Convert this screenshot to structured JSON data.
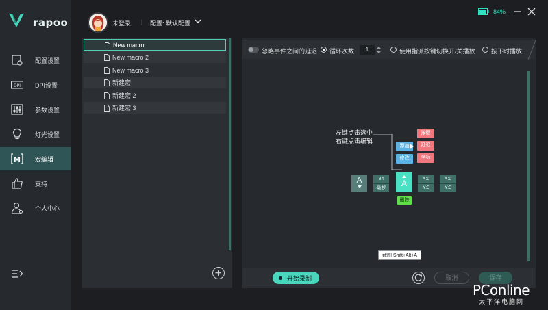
{
  "app": {
    "brand": "rapoo",
    "user_name": "未登录",
    "separator": "|",
    "profile_label": "配置: 默认配置",
    "battery_pct": "84%",
    "colors": {
      "accent": "#4ad6bd",
      "active_nav": "#2f5556",
      "background": "#1c1e21"
    }
  },
  "sidebar": {
    "items": [
      {
        "label": "配置设置",
        "icon": "config-icon",
        "active": false
      },
      {
        "label": "DPI设置",
        "icon": "dpi-icon",
        "active": false
      },
      {
        "label": "参数设置",
        "icon": "sliders-icon",
        "active": false
      },
      {
        "label": "灯光设置",
        "icon": "bulb-icon",
        "active": false
      },
      {
        "label": "宏编辑",
        "icon": "macro-icon",
        "active": true
      },
      {
        "label": "支持",
        "icon": "thumb-up-icon",
        "active": false
      },
      {
        "label": "个人中心",
        "icon": "user-icon",
        "active": false
      }
    ],
    "dpi_icon_text": "DPI",
    "macro_icon_text": "M"
  },
  "macros": {
    "items": [
      {
        "name": "New macro",
        "selected": true
      },
      {
        "name": "New macro 2",
        "selected": false
      },
      {
        "name": "New macro 3",
        "selected": false
      },
      {
        "name": "新建宏",
        "selected": false
      },
      {
        "name": "新建宏 2",
        "selected": false
      },
      {
        "name": "新建宏 3",
        "selected": false
      }
    ]
  },
  "options": {
    "ignore_delay": "忽略事件之间的延迟",
    "ignore_delay_on": false,
    "loop_count_label": "循环次数",
    "loop_count": "1",
    "toggle_play_label": "使用指派按键切换开/关播放",
    "hold_play_label": "按下时播放",
    "selected_mode": "loop"
  },
  "editor": {
    "hint_line1": "左键点击选中",
    "hint_line2": "右键点击编辑",
    "chips": {
      "key": "按键",
      "add": "添加",
      "delay": "延迟",
      "modify": "修改",
      "coord": "坐标",
      "delete": "删除"
    },
    "nodes": {
      "key1": "A",
      "delay_value": "34",
      "delay_unit": "毫秒",
      "key2": "A",
      "x1": "X:0",
      "y1": "Y:0",
      "x2": "X:0",
      "y2": "Y:0"
    },
    "tooltip": "截图 Shift+Alt+A"
  },
  "footer": {
    "record": "开始录制",
    "cancel": "取消",
    "save": "保存"
  },
  "watermark": {
    "brand": "PConline",
    "sub": "太平洋电脑网"
  }
}
